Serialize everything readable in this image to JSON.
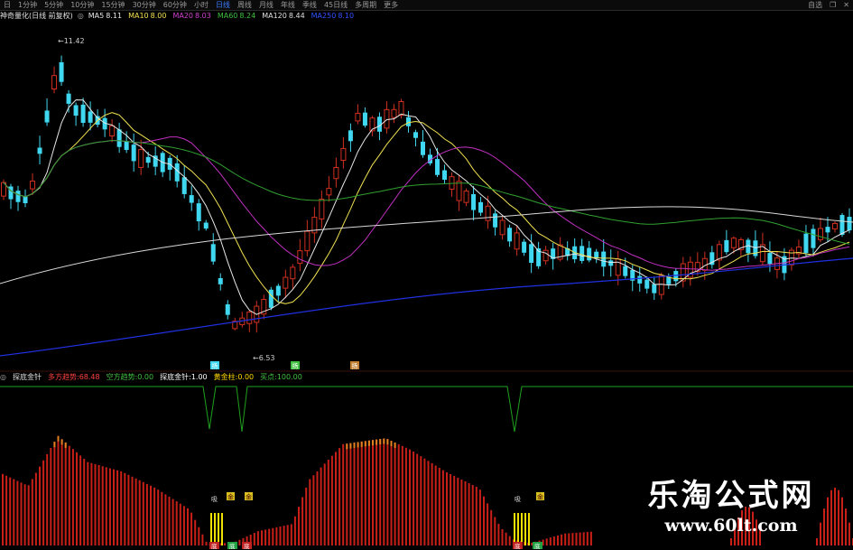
{
  "toolbar": {
    "items": [
      "日",
      "1分钟",
      "5分钟",
      "10分钟",
      "15分钟",
      "30分钟",
      "60分钟",
      "小时",
      "日线",
      "周线",
      "月线",
      "年线",
      "季线",
      "45日线",
      "多周期",
      "更多"
    ],
    "active_index": 8,
    "right_items": [
      "自选"
    ],
    "right_icons": [
      "restore-icon",
      "close-icon"
    ]
  },
  "main_legend": {
    "title": "神奇量化(日线 前复权)",
    "items": [
      {
        "label": "MA5",
        "value": "8.11",
        "color": "#e8e8e8"
      },
      {
        "label": "MA10",
        "value": "8.00",
        "color": "#f0e050"
      },
      {
        "label": "MA20",
        "value": "8.03",
        "color": "#d040d0"
      },
      {
        "label": "MA60",
        "value": "8.24",
        "color": "#40c040"
      },
      {
        "label": "MA120",
        "value": "8.44",
        "color": "#e0e0e0"
      },
      {
        "label": "MA250",
        "value": "8.10",
        "color": "#3050ff"
      }
    ]
  },
  "price_annotations": {
    "high": "11.42",
    "low": "6.53",
    "markers": [
      "扬",
      "扬",
      "扬"
    ]
  },
  "sub_legend": {
    "title": "探底金针",
    "items": [
      {
        "label": "多方趋势:",
        "value": "68.48",
        "color": "#ff4040"
      },
      {
        "label": "空方趋势:",
        "value": "0.00",
        "color": "#40c040"
      },
      {
        "label": "探底金针:",
        "value": "1.00",
        "color": "#ffffff"
      },
      {
        "label": "黄金柱:",
        "value": "0.00",
        "color": "#ffd700"
      },
      {
        "label": "买点:",
        "value": "100.00",
        "color": "#40c040"
      }
    ]
  },
  "sub_annotations": {
    "signal_top": "吸",
    "signal_gold": "金",
    "signal_bottom": "底"
  },
  "watermark": {
    "title": "乐淘公式网",
    "url": "www.60lt.com"
  },
  "colors": {
    "up": "#d03020",
    "down": "#40d8f0",
    "bar_red": "#c82018",
    "bar_top": "#e08020",
    "trend_line": "#20a020",
    "ma5": "#e8e8e8",
    "ma10": "#f0e050",
    "ma20": "#c030c0",
    "ma60": "#30a030",
    "ma120": "#d8d8d8",
    "ma250": "#2030e0"
  }
}
